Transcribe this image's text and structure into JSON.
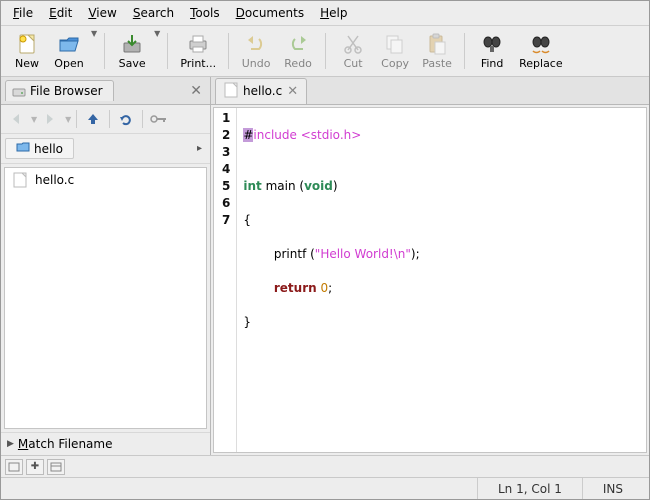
{
  "menu": {
    "file": {
      "label": "File",
      "ul": "F"
    },
    "edit": {
      "label": "Edit",
      "ul": "E"
    },
    "view": {
      "label": "View",
      "ul": "V"
    },
    "search": {
      "label": "Search",
      "ul": "S"
    },
    "tools": {
      "label": "Tools",
      "ul": "T"
    },
    "documents": {
      "label": "Documents",
      "ul": "D"
    },
    "help": {
      "label": "Help",
      "ul": "H"
    }
  },
  "toolbar": {
    "new": "New",
    "open": "Open",
    "save": "Save",
    "print": "Print...",
    "undo": "Undo",
    "redo": "Redo",
    "cut": "Cut",
    "copy": "Copy",
    "paste": "Paste",
    "find": "Find",
    "replace": "Replace"
  },
  "sidebar": {
    "panel_title": "File Browser",
    "path_segment": "hello",
    "files": [
      {
        "name": "hello.c"
      }
    ],
    "match_label": "Match Filename"
  },
  "editor": {
    "tab_name": "hello.c",
    "code": {
      "l1a": "#",
      "l1b": "include",
      "l1c": " <stdio.h>",
      "l2": "",
      "l3_int": "int",
      "l3_main": " main (",
      "l3_void": "void",
      "l3_end": ")",
      "l4": "{",
      "l5a": "        printf (",
      "l5b": "\"Hello World!\\n\"",
      "l5c": ");",
      "l6a": "        ",
      "l6_return": "return",
      "l6_sp": " ",
      "l6_zero": "0",
      "l6_semi": ";",
      "l7": "}"
    },
    "line_numbers": [
      "1",
      "2",
      "3",
      "4",
      "5",
      "6",
      "7"
    ]
  },
  "status": {
    "position": "Ln 1, Col 1",
    "mode": "INS"
  }
}
